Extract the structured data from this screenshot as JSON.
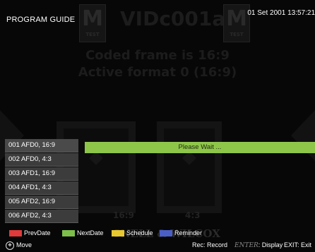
{
  "header": {
    "title": "PROGRAM GUIDE",
    "datetime": "01 Set 2001 13:57:21"
  },
  "background_test_pattern": {
    "stream_name": "VIDc001a",
    "logo_letter": "M",
    "logo_sublabel": "TEST",
    "coded_frame": "Coded frame is 16:9",
    "active_format": "Active format 0 (16:9)",
    "left_tv_label": "16:9",
    "right_tv_label": "4:3",
    "watermark": "SNELL & WILCOX"
  },
  "channel_list": {
    "items": [
      {
        "label": "001  AFD0, 16:9"
      },
      {
        "label": "002  AFD0, 4:3"
      },
      {
        "label": "003  AFD1, 16:9"
      },
      {
        "label": "004  AFD1, 4:3"
      },
      {
        "label": "005  AFD2, 16:9"
      },
      {
        "label": "006  AFD2, 4:3"
      }
    ]
  },
  "status": {
    "message": "Please Wait ..."
  },
  "legend": {
    "red": {
      "label": "PrevDate",
      "color": "#e03a3a"
    },
    "green": {
      "label": "NextDate",
      "color": "#7cc04a"
    },
    "yellow": {
      "label": "Schedule",
      "color": "#e8c82e"
    },
    "blue": {
      "label": "Reminder",
      "color": "#4a5ec8"
    }
  },
  "help": {
    "move": "Move",
    "record": "Rec: Record",
    "enter_key": "ENTER",
    "display": ": Display",
    "exit": "EXIT: Exit"
  }
}
